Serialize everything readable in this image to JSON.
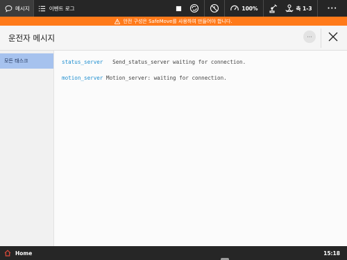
{
  "topbar": {
    "tabs": [
      {
        "label": "메시지",
        "icon": "chat-icon",
        "active": true
      },
      {
        "label": "이벤트 로그",
        "icon": "list-icon",
        "active": false
      }
    ],
    "speed": "100%",
    "axis": "축 1-3",
    "more": "···"
  },
  "warning": {
    "icon": "warning-icon",
    "text": "안전 구성은 SafeMove를 사용하여 만들어야 합니다."
  },
  "header": {
    "title": "운전자 메시지",
    "more_label": "···"
  },
  "sidebar": {
    "items": [
      {
        "label": "모든 태스크",
        "selected": true
      }
    ]
  },
  "messages": [
    {
      "source": "status_server",
      "text": "Send_status_server waiting for connection."
    },
    {
      "source": "motion_server",
      "text": "Motion_server: waiting for connection."
    }
  ],
  "bottombar": {
    "home_label": "Home",
    "time": "15:18"
  },
  "colors": {
    "topbar": "#262626",
    "warning": "#ff7a1a",
    "selected_item": "#a6c2ee",
    "source_text": "#1f8fd0"
  }
}
